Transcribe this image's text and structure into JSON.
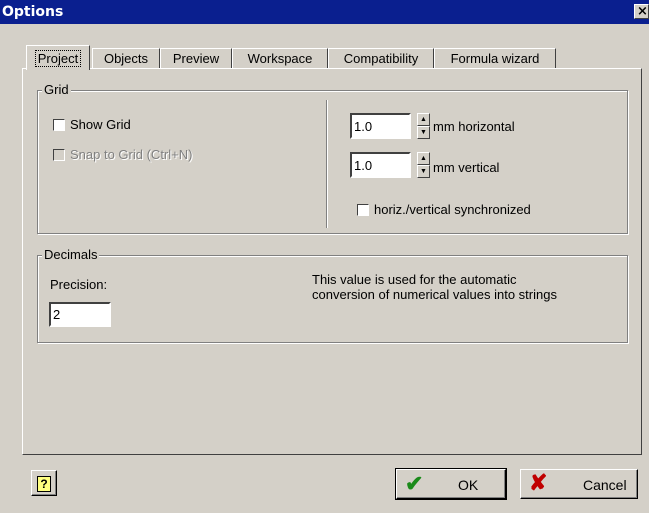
{
  "window": {
    "title": "Options",
    "close_glyph": "×"
  },
  "tabs": [
    {
      "label": "Project",
      "active": true
    },
    {
      "label": "Objects",
      "active": false
    },
    {
      "label": "Preview",
      "active": false
    },
    {
      "label": "Workspace",
      "active": false
    },
    {
      "label": "Compatibility",
      "active": false
    },
    {
      "label": "Formula wizard",
      "active": false
    }
  ],
  "grid": {
    "group_label": "Grid",
    "show_grid_label": "Show Grid",
    "show_grid_checked": false,
    "snap_label": "Snap to Grid (Ctrl+N)",
    "snap_checked": false,
    "snap_enabled": false,
    "horizontal_value": "1.0",
    "horizontal_unit": "mm horizontal",
    "vertical_value": "1.0",
    "vertical_unit": "mm vertical",
    "sync_label": "horiz./vertical synchronized",
    "sync_checked": false
  },
  "decimals": {
    "group_label": "Decimals",
    "precision_label": "Precision:",
    "precision_value": "2",
    "info_line1": "This value is used for the automatic",
    "info_line2": "conversion of numerical values into strings"
  },
  "buttons": {
    "help_glyph": "?",
    "ok_label": "OK",
    "cancel_label": "Cancel"
  },
  "icons": {
    "ok": "checkmark-icon",
    "cancel": "x-mark-icon",
    "help": "help-icon"
  },
  "colors": {
    "titlebar": "#0a1f8f",
    "face": "#d4d0c8",
    "ok_check": "#1a8a1a",
    "cancel_x": "#c00000"
  }
}
